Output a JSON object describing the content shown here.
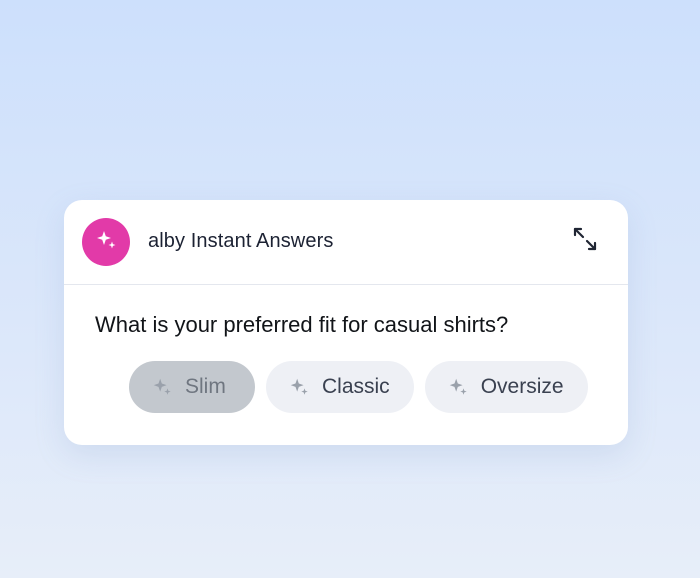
{
  "colors": {
    "accent": "#e23aa8",
    "selected_chip": "#c3c8ce",
    "chip": "#eef0f5"
  },
  "widget": {
    "title": "alby Instant Answers",
    "avatar_icon": "sparkle-icon",
    "expand_icon": "expand-icon"
  },
  "question": "What is your preferred fit for casual shirts?",
  "options": [
    {
      "label": "Slim",
      "icon": "sparkle-icon",
      "selected": true
    },
    {
      "label": "Classic",
      "icon": "sparkle-icon",
      "selected": false
    },
    {
      "label": "Oversize",
      "icon": "sparkle-icon",
      "selected": false
    }
  ]
}
